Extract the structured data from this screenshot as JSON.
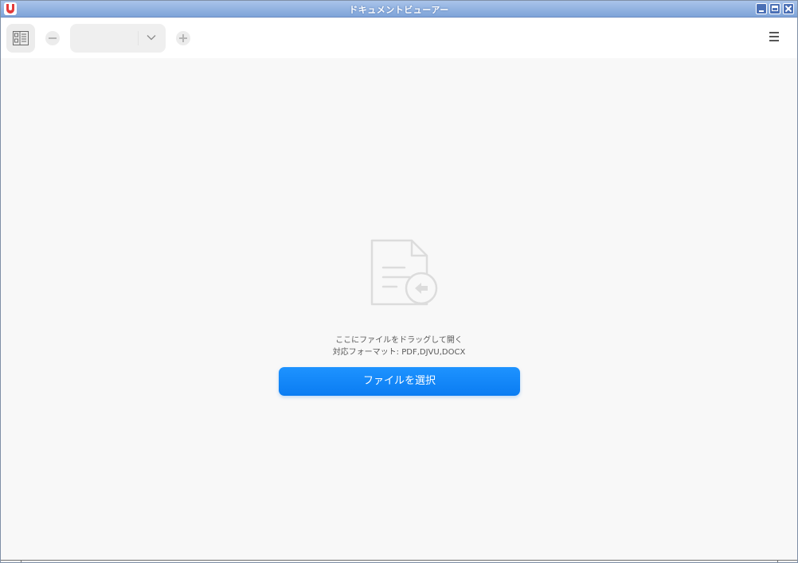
{
  "window": {
    "title": "ドキュメントビューアー"
  },
  "toolbar": {
    "zoom_value": ""
  },
  "content": {
    "drop_hint": "ここにファイルをドラッグして開く",
    "formats_hint": "対応フォーマット: PDF,DJVU,DOCX",
    "select_button_label": "ファイルを選択"
  },
  "colors": {
    "accent": "#0a7cf2",
    "titlebar": "#7ea3d8"
  },
  "icons": {
    "app": "document-viewer-app-icon",
    "thumbnails": "thumbnails-icon",
    "zoom_out": "minus-icon",
    "zoom_in": "plus-icon",
    "dropdown": "chevron-down-icon",
    "menu": "hamburger-menu-icon",
    "placeholder": "document-import-icon"
  }
}
